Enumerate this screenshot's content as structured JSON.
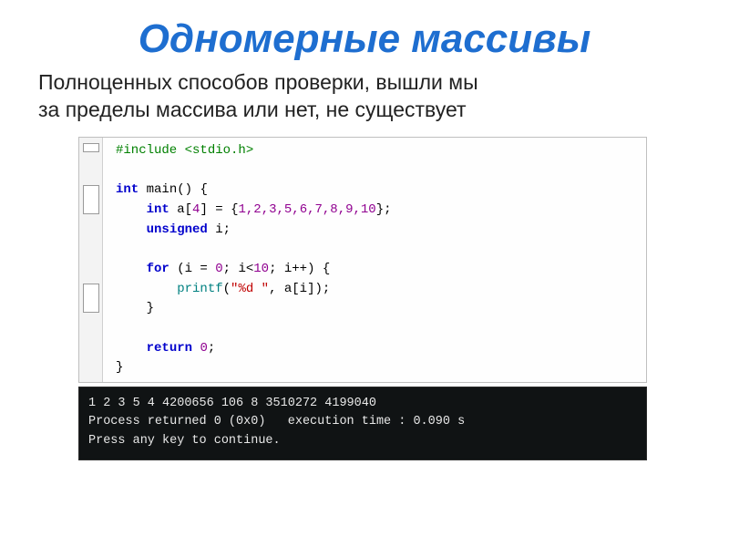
{
  "title": "Одномерные массивы",
  "subtitle_line1": "Полноценных способов проверки, вышли мы",
  "subtitle_line2": "за пределы массива или нет, не существует",
  "code": {
    "include": "#include <stdio.h>",
    "int_kw": "int",
    "main_name": " main",
    "main_paren": "()",
    "brace_open_sp": " {",
    "arr_decl_open": " a",
    "bracket_l": "[",
    "arr_size": "4",
    "bracket_r": "]",
    "eq_sp": " = ",
    "init_open": "{",
    "init_vals": "1,2,3,5,6,7,8,9,10",
    "init_close": "}",
    "semicolon": ";",
    "unsigned_kw": "unsigned",
    "var_i": " i",
    "for_kw": "for",
    "for_open": " (i = ",
    "zero": "0",
    "for_mid1": "; i<",
    "ten": "10",
    "for_mid2": "; i++) {",
    "printf_name": "printf",
    "printf_open": "(",
    "fmt_str": "\"%d \"",
    "printf_rest": ", a[i]);",
    "brace_close": "}",
    "return_kw": "return",
    "ret_sp": " ",
    "ret_zero": "0"
  },
  "terminal": {
    "line1": "1 2 3 5 4 4200656 106 8 3510272 4199040",
    "line2": "Process returned 0 (0x0)   execution time : 0.090 s",
    "line3": "Press any key to continue."
  }
}
